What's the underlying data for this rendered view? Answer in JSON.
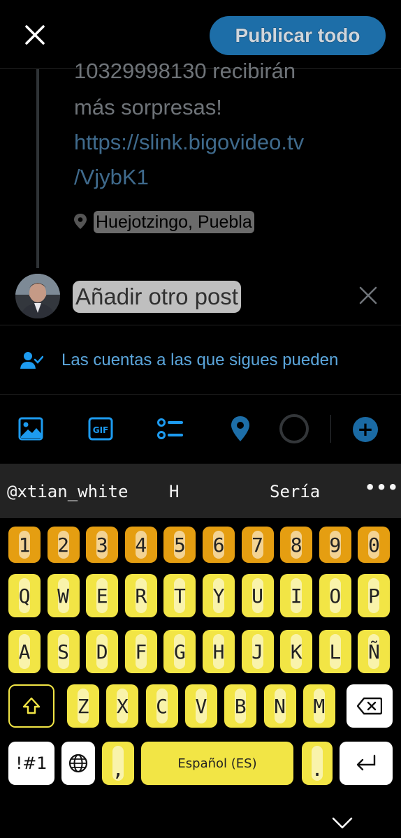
{
  "header": {
    "publish_label": "Publicar todo"
  },
  "thread": {
    "cut_line": "10329998130 recibirán",
    "line2": "más sorpresas!",
    "link_line1": "https://slink.bigovideo.tv",
    "link_line2": "/VjybK1",
    "location": "Huejotzingo, Puebla"
  },
  "compose": {
    "add_post_label": "Añadir otro post",
    "reply_setting": "Las cuentas a las que sigues pueden"
  },
  "toolbar": {
    "items": [
      "image-icon",
      "gif-icon",
      "poll-icon",
      "location-pin-icon",
      "progress-ring",
      "add-post-plus-icon"
    ],
    "gif_label": "GIF",
    "plus_label": "+"
  },
  "keyboard": {
    "suggestions": [
      "@xtian_white",
      "H",
      "Sería"
    ],
    "more_label": "•••",
    "row_numbers": [
      "1",
      "2",
      "3",
      "4",
      "5",
      "6",
      "7",
      "8",
      "9",
      "0"
    ],
    "row1": [
      "Q",
      "W",
      "E",
      "R",
      "T",
      "Y",
      "U",
      "I",
      "O",
      "P"
    ],
    "row2": [
      "A",
      "S",
      "D",
      "F",
      "G",
      "H",
      "J",
      "K",
      "L",
      "Ñ"
    ],
    "row3": [
      "Z",
      "X",
      "C",
      "V",
      "B",
      "N",
      "M"
    ],
    "symbols_label": "!#1",
    "comma_label": ",",
    "space_label": "Español (ES)",
    "period_label": "."
  },
  "colors": {
    "accent": "#1d9bf0",
    "key_yellow": "#f2e545",
    "key_orange": "#e59e11"
  }
}
